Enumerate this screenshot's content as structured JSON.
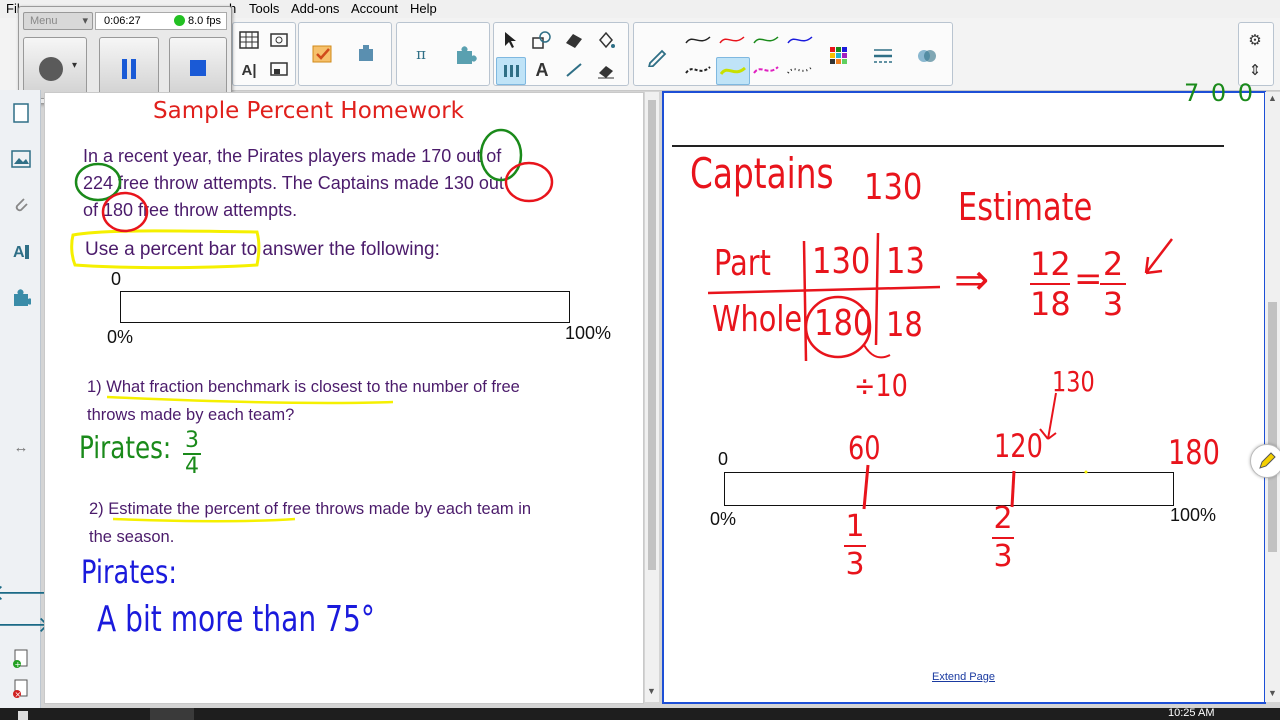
{
  "menu": {
    "file": "Fil",
    "insert_tail": "h",
    "tools": "Tools",
    "addons": "Add-ons",
    "account": "Account",
    "help": "Help"
  },
  "recorder": {
    "menu_label": "Menu",
    "elapsed": "0:06:27",
    "fps": "8.0 fps"
  },
  "left_page": {
    "title": "Sample Percent Homework",
    "problem_lines": [
      "In a recent year, the Pirates players made 170 out of",
      "224 free throw attempts. The Captains made 130 out",
      "of 180 free throw attempts."
    ],
    "instruction": "Use a percent bar to answer the following:",
    "bar_zero": "0",
    "bar_start_pct": "0%",
    "bar_end_pct": "100%",
    "q1_lines": [
      "1) What fraction benchmark is closest to the number of free",
      "throws made by each team?"
    ],
    "q1_answer_label": "Pirates:",
    "q1_answer_num": "3",
    "q1_answer_den": "4",
    "q2_lines": [
      "2) Estimate the percent of free throws made by each team in",
      "the season."
    ],
    "q2_answer_label": "Pirates:",
    "q2_answer": "A bit more than 75°"
  },
  "right_page": {
    "header_partial": "7 0 0",
    "captains": "Captains",
    "captains_value": "130",
    "estimate": "Estimate",
    "table_part": "Part",
    "table_whole": "Whole",
    "part_1": "130",
    "part_2": "13",
    "whole_1": "180",
    "whole_2": "18",
    "divide_note": "÷10",
    "fraction_num": "12",
    "fraction_den": "18",
    "equals": "=",
    "result_num": "2",
    "result_den": "3",
    "arrow": "⇒",
    "bar_zero": "0",
    "bar_start_pct": "0%",
    "bar_end_pct": "100%",
    "mark_60": "60",
    "mark_120": "120",
    "mark_130": "130",
    "mark_180": "180",
    "frac_third_num": "1",
    "frac_third_den": "3",
    "frac_twothirds_num": "2",
    "frac_twothirds_den": "3",
    "extend_page": "Extend Page"
  },
  "taskbar": {
    "clock": "10:25 AM"
  },
  "colors": {
    "title_red": "#e0201c",
    "pen_red": "#e8141c",
    "pen_green": "#1a8a1a",
    "pen_blue": "#1a1adc",
    "highlight_yellow": "#f5f000",
    "text_purple": "#4b1b6b",
    "page_border_blue": "#1d4fd6"
  }
}
